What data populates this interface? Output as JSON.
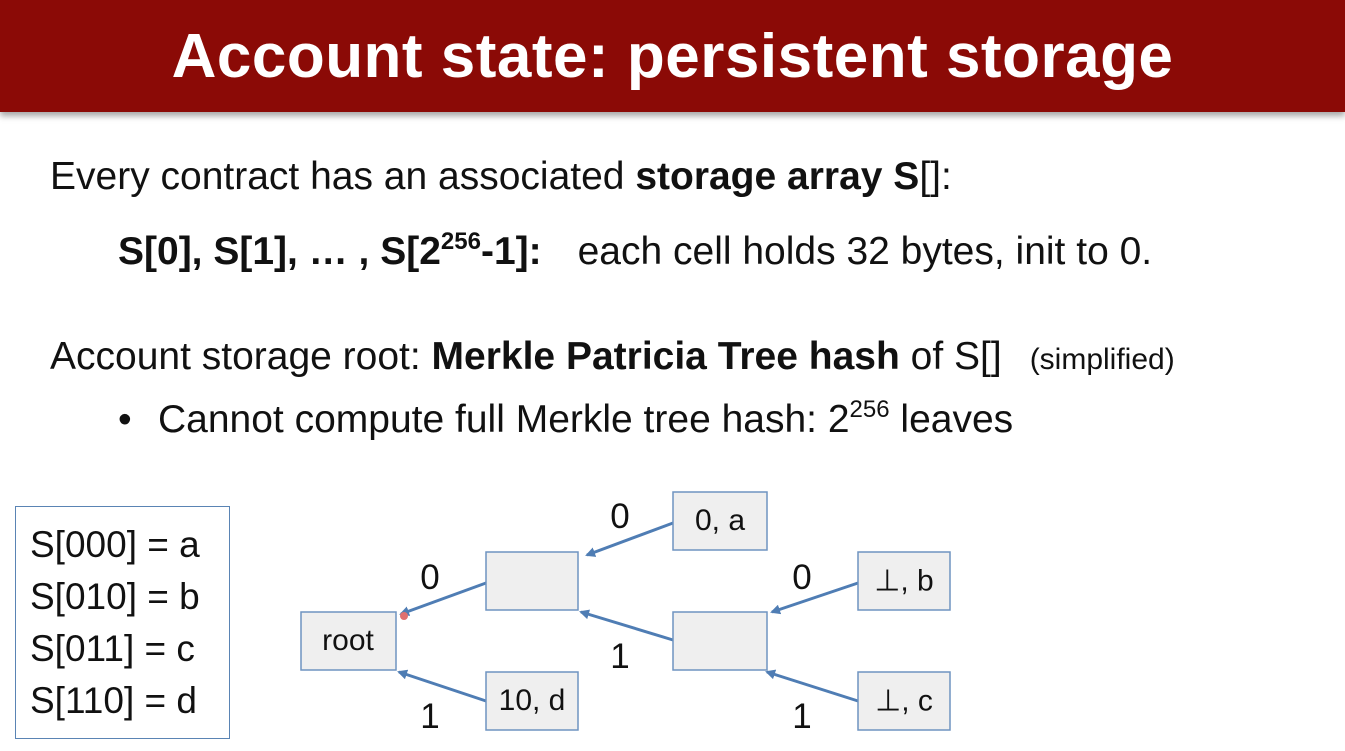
{
  "slide": {
    "title": "Account state:  persistent storage",
    "line1_pre": "Every contract has an associated ",
    "line1_bold": "storage array S",
    "line1_post": "[]:",
    "line2_bold_a": "S[0],  S[1],  …  ,  S[2",
    "line2_sup": "256",
    "line2_bold_b": "-1]:",
    "line2_post": "each cell holds 32 bytes,  init to 0.",
    "line3_pre": "Account storage root: ",
    "line3_bold": "Merkle Patricia Tree hash",
    "line3_post": " of S[]",
    "line3_small": "(simplified)",
    "bullet_symbol": "•",
    "bullet_text": "Cannot compute full Merkle tree hash:  2",
    "bullet_sup": "256",
    "bullet_post": " leaves"
  },
  "storage_entries": [
    "S[000] = a",
    "S[010] = b",
    "S[011] = c",
    "S[110] = d"
  ],
  "tree": {
    "nodes": {
      "root": "root",
      "inner_top": "",
      "inner_right": "",
      "leaf_0a": "0, a",
      "leaf_b": "⊥, b",
      "leaf_c": "⊥, c",
      "leaf_10d": "10, d"
    },
    "edge_labels": {
      "leaf_0a_to_inner_top": "0",
      "inner_top_to_root": "0",
      "leaf_b_to_inner_right": "0",
      "inner_right_to_inner_top": "1",
      "leaf_10d_to_root": "1",
      "leaf_c_to_inner_right": "1"
    }
  },
  "colors": {
    "title_bar": "#8b0a06",
    "node_fill": "#efefef",
    "node_border": "#6f94c0",
    "arrow": "#4f7db4"
  }
}
